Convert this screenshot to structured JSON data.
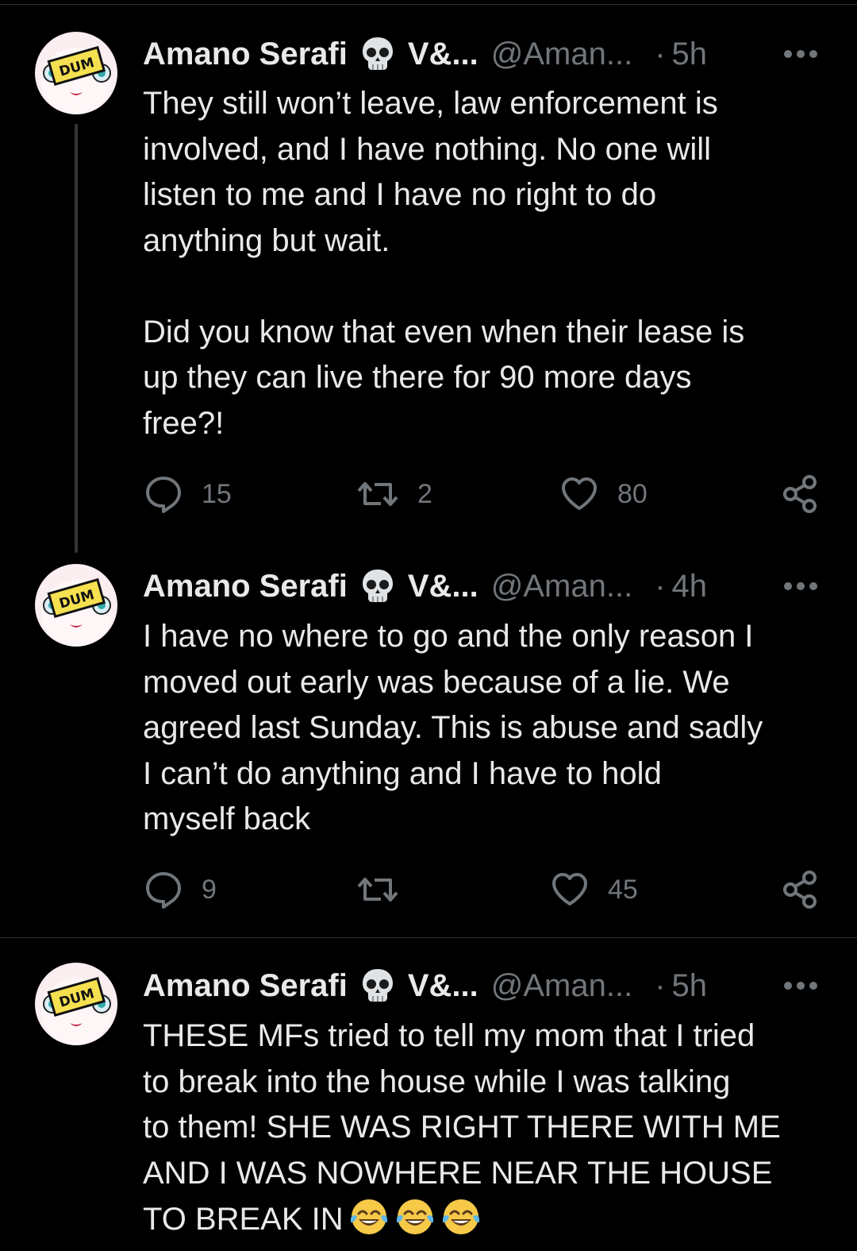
{
  "tweets": [
    {
      "author_name": "Amano Serafi",
      "name_icon": "skull-emoji",
      "name_suffix": "V&...",
      "handle": "@Aman...",
      "separator": "·",
      "time": "5h",
      "text": "They still won’t leave, law enforcement is\ninvolved, and I have nothing. No one will\nlisten to me and I have no right to do\nanything but wait.\n\nDid you know that even when their lease is\nup they can live there for 90 more days\nfree?!",
      "replies": "15",
      "retweets": "2",
      "likes": "80"
    },
    {
      "author_name": "Amano Serafi",
      "name_icon": "skull-emoji",
      "name_suffix": "V&...",
      "handle": "@Aman...",
      "separator": "·",
      "time": "4h",
      "text": "I have no where to go and the only reason I\nmoved out early was because of a lie. We\nagreed last Sunday. This is abuse and sadly\nI can’t do anything and I have to hold\nmyself back",
      "replies": "9",
      "retweets": "",
      "likes": "45"
    },
    {
      "author_name": "Amano Serafi",
      "name_icon": "skull-emoji",
      "name_suffix": "V&...",
      "handle": "@Aman...",
      "separator": "·",
      "time": "5h",
      "text": "THESE MFs tried to tell my mom that I tried\nto break into the house while I was talking\nto them! SHE WAS RIGHT THERE WITH ME\nAND I WAS NOWHERE NEAR THE HOUSE\nTO BREAK IN",
      "trailing_emoji": [
        "tears-of-joy-emoji",
        "tears-of-joy-emoji",
        "tears-of-joy-emoji"
      ],
      "replies": "",
      "retweets": "",
      "likes": ""
    }
  ],
  "avatar": {
    "sticker_text": "DUM"
  },
  "colors": {
    "background": "#000000",
    "text": "#e7e9ea",
    "muted": "#71767b",
    "divider": "#2f3336",
    "sticker": "#f5e050"
  }
}
